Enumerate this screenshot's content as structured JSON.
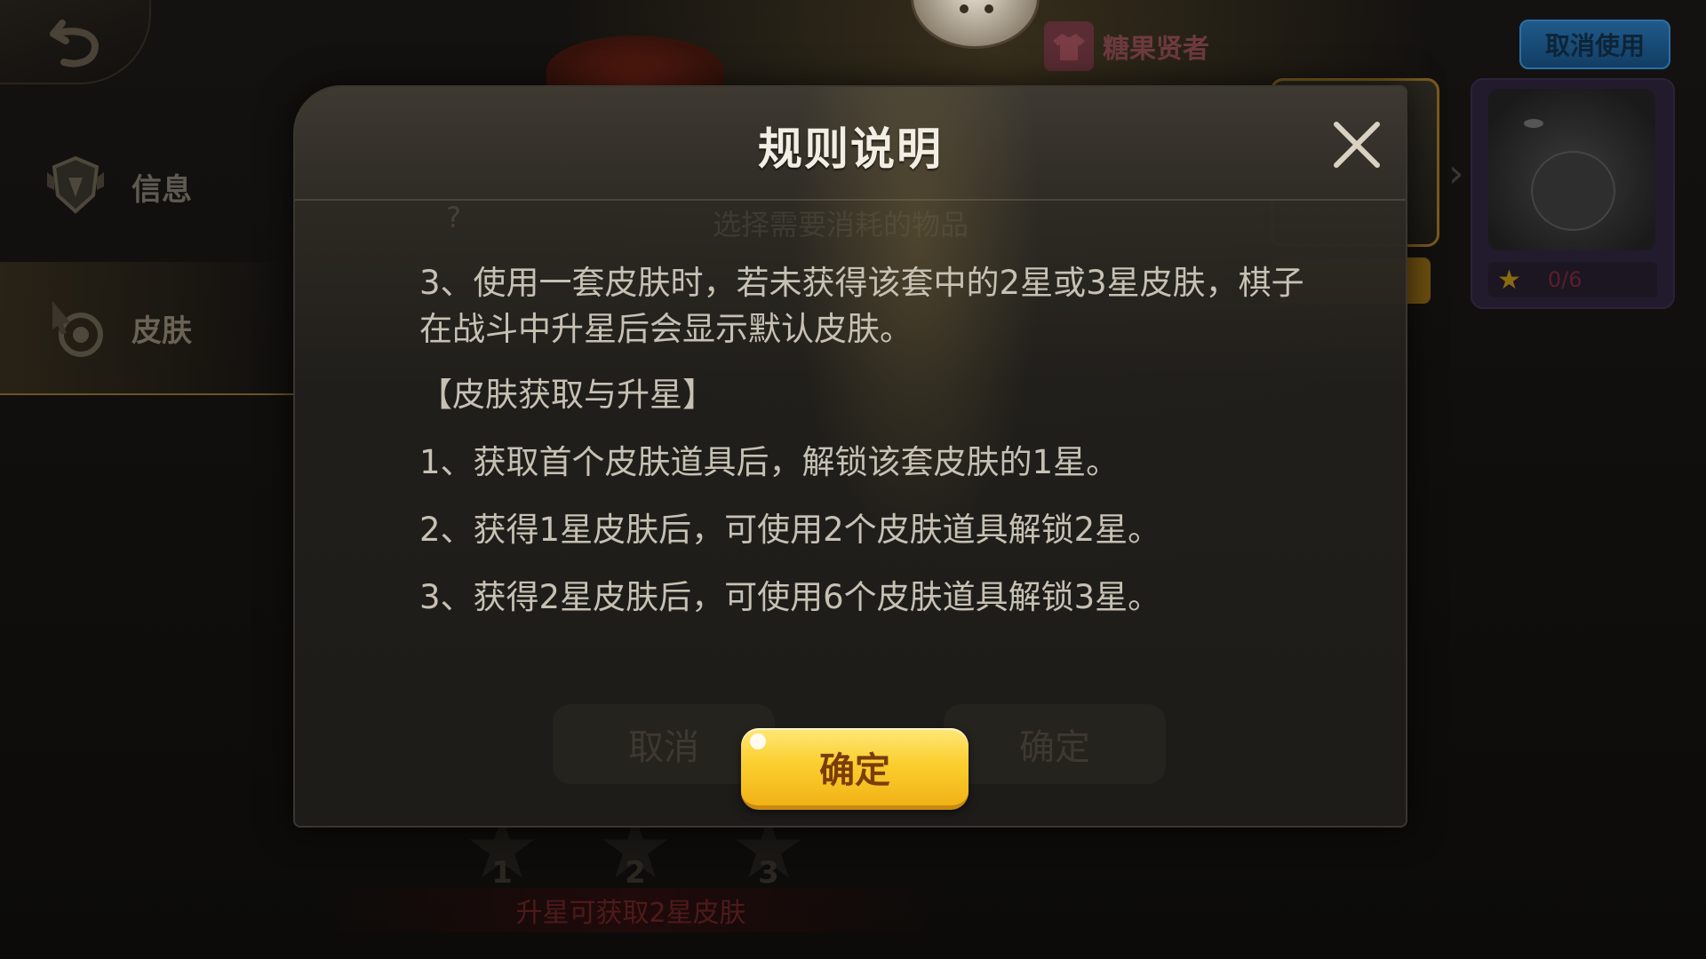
{
  "background": {
    "sidebar": {
      "items": [
        {
          "label": "信息",
          "icon": "shield-emblem-icon"
        },
        {
          "label": "皮肤",
          "icon": "pointer-target-icon"
        }
      ]
    },
    "title_tag": {
      "icon": "shirt-icon",
      "label": "糖果贤者"
    },
    "cancel_use_label": "取消使用",
    "skin_progress": {
      "icon": "star-icon",
      "text": "0/6"
    },
    "hint_text": "选择需要消耗的物品",
    "hint_prefix": "?",
    "ghost_buttons": {
      "cancel": "取消",
      "confirm": "确定"
    },
    "star_levels": [
      "1",
      "2",
      "3"
    ],
    "upgrade_text": "升星可获取2星皮肤"
  },
  "modal": {
    "title": "规则说明",
    "close_icon": "close-icon",
    "paragraphs": [
      "3、使用一套皮肤时，若未获得该套中的2星或3星皮肤，棋子在战斗中升星后会显示默认皮肤。",
      "【皮肤获取与升星】",
      "1、获取首个皮肤道具后，解锁该套皮肤的1星。",
      "2、获得1星皮肤后，可使用2个皮肤道具解锁2星。",
      "3、获得2星皮肤后，可使用6个皮肤道具解锁3星。"
    ],
    "confirm_label": "确定"
  },
  "colors": {
    "confirm_button": "#fbcf2f",
    "confirm_text": "#7a3d0a",
    "modal_text": "#c7c1b4",
    "title_text": "#f3eee4",
    "cancel_use_button": "#1f5a8a"
  }
}
